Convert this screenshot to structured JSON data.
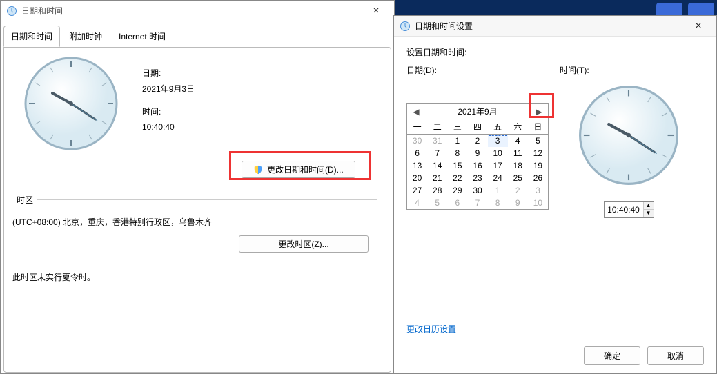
{
  "left": {
    "title": "日期和时间",
    "tabs": {
      "t1": "日期和时间",
      "t2": "附加时钟",
      "t3": "Internet 时间"
    },
    "labels": {
      "date": "日期:",
      "time": "时间:"
    },
    "date_val": "2021年9月3日",
    "time_val": "10:40:40",
    "change_dt_btn": "更改日期和时间(D)...",
    "tz_head": "时区",
    "tz_val": "(UTC+08:00) 北京，重庆，香港特别行政区，乌鲁木齐",
    "change_tz_btn": "更改时区(Z)...",
    "dst_note": "此时区未实行夏令时。"
  },
  "right": {
    "title": "日期和时间设置",
    "prompt": "设置日期和时间:",
    "date_label": "日期(D):",
    "time_label": "时间(T):",
    "cal_title": "2021年9月",
    "dow": {
      "d1": "一",
      "d2": "二",
      "d3": "三",
      "d4": "四",
      "d5": "五",
      "d6": "六",
      "d7": "日"
    },
    "time_val": "10:40:40",
    "change_cal_link": "更改日历设置",
    "ok": "确定",
    "cancel": "取消",
    "cells": [
      {
        "n": "30",
        "c": "out"
      },
      {
        "n": "31",
        "c": "out"
      },
      {
        "n": "1",
        "c": ""
      },
      {
        "n": "2",
        "c": ""
      },
      {
        "n": "3",
        "c": "sel"
      },
      {
        "n": "4",
        "c": ""
      },
      {
        "n": "5",
        "c": ""
      },
      {
        "n": "6",
        "c": ""
      },
      {
        "n": "7",
        "c": ""
      },
      {
        "n": "8",
        "c": ""
      },
      {
        "n": "9",
        "c": ""
      },
      {
        "n": "10",
        "c": ""
      },
      {
        "n": "11",
        "c": ""
      },
      {
        "n": "12",
        "c": ""
      },
      {
        "n": "13",
        "c": ""
      },
      {
        "n": "14",
        "c": ""
      },
      {
        "n": "15",
        "c": ""
      },
      {
        "n": "16",
        "c": ""
      },
      {
        "n": "17",
        "c": ""
      },
      {
        "n": "18",
        "c": ""
      },
      {
        "n": "19",
        "c": ""
      },
      {
        "n": "20",
        "c": ""
      },
      {
        "n": "21",
        "c": ""
      },
      {
        "n": "22",
        "c": ""
      },
      {
        "n": "23",
        "c": ""
      },
      {
        "n": "24",
        "c": ""
      },
      {
        "n": "25",
        "c": ""
      },
      {
        "n": "26",
        "c": ""
      },
      {
        "n": "27",
        "c": ""
      },
      {
        "n": "28",
        "c": ""
      },
      {
        "n": "29",
        "c": ""
      },
      {
        "n": "30",
        "c": ""
      },
      {
        "n": "1",
        "c": "out"
      },
      {
        "n": "2",
        "c": "out"
      },
      {
        "n": "3",
        "c": "out"
      },
      {
        "n": "4",
        "c": "out"
      },
      {
        "n": "5",
        "c": "out"
      },
      {
        "n": "6",
        "c": "out"
      },
      {
        "n": "7",
        "c": "out"
      },
      {
        "n": "8",
        "c": "out"
      },
      {
        "n": "9",
        "c": "out"
      },
      {
        "n": "10",
        "c": "out"
      }
    ]
  }
}
